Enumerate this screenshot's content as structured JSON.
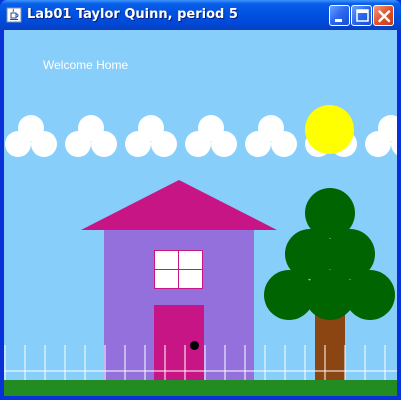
{
  "window": {
    "title": "Lab01 Taylor Quinn, period 5",
    "icon": "java-cup-icon",
    "buttons": [
      "minimize",
      "maximize",
      "close"
    ]
  },
  "canvas": {
    "welcome_text": "Welcome Home",
    "colors": {
      "sky": "#87cefa",
      "cloud": "#ffffff",
      "sun": "#ffff00",
      "roof": "#c71585",
      "house": "#9370db",
      "door": "#c71585",
      "window": "#ffffff",
      "knob": "#000000",
      "trunk": "#8b4513",
      "leaves": "#006400",
      "fence": "#ffffff",
      "grass": "#228b22"
    }
  }
}
